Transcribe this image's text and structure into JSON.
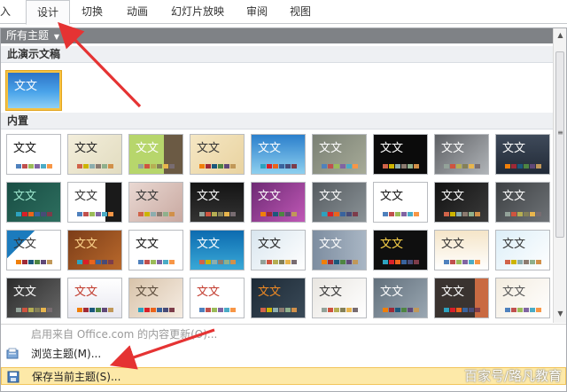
{
  "ribbon": {
    "tabs": [
      {
        "label": "插入",
        "display": "插入"
      },
      {
        "label": "设计"
      },
      {
        "label": "切换"
      },
      {
        "label": "动画"
      },
      {
        "label": "幻灯片放映"
      },
      {
        "label": "审阅"
      },
      {
        "label": "视图"
      }
    ],
    "active_tab": "设计"
  },
  "gallery": {
    "filter_label": "所有主题",
    "sections": {
      "this_presentation": "此演示文稿",
      "builtin": "内置"
    },
    "thumbnail_text": "文文"
  },
  "menu": {
    "office_update": "启用来自 Office.com 的内容更新(O)...",
    "browse_themes": "浏览主题(M)...",
    "save_current_theme": "保存当前主题(S)..."
  },
  "colors": {
    "annotation_arrow": "#e53333",
    "highlight": "#fde9a8"
  },
  "watermark": "百家号/路凡教育"
}
